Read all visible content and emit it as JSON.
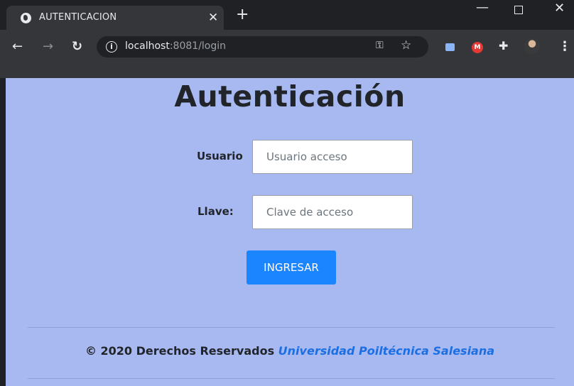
{
  "browser": {
    "tab_title": "AUTENTICACION",
    "tab_close": "✕",
    "new_tab": "+",
    "url_host": "localhost",
    "url_rest": ":8081/login",
    "info_symbol": "i",
    "icons": [
      "globe-icon",
      "back-arrow-icon",
      "forward-arrow-icon",
      "reload-icon",
      "info-icon",
      "key-icon",
      "star-icon",
      "extension-icon",
      "puzzle-icon",
      "avatar",
      "menu-icon"
    ]
  },
  "page": {
    "heading": "Autenticación",
    "username_label": "Usuario",
    "username_placeholder": "Usuario acceso",
    "password_label": "Llave:",
    "password_placeholder": "Clave de acceso",
    "submit_label": "INGRESAR",
    "footer_text": "© 2020 Derechos Reservados",
    "footer_link": "Universidad Poiltécnica Salesiana"
  },
  "colors": {
    "page_background": "#a8b9f2",
    "button": "#1b84ff",
    "link": "#1b6fe3",
    "browser_chrome": "#35363a"
  }
}
